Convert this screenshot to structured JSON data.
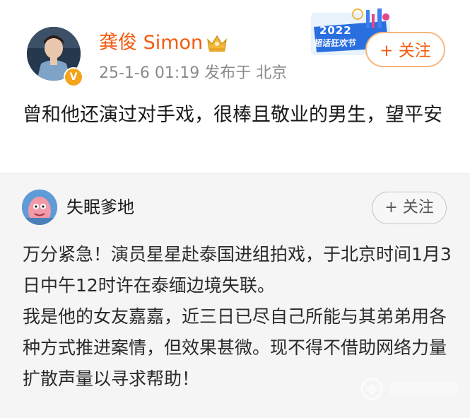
{
  "post": {
    "username": "龚俊 Simon",
    "meta": "25-1-6 01:19  发布于 北京",
    "follow_label": "+ 关注",
    "text": "曾和他还演过对手戏，很棒且敬业的男生，望平安",
    "banner_year": "2022",
    "banner_label": "超话狂欢节",
    "verified_badge": "V"
  },
  "repost": {
    "username": "失眠爹地",
    "follow_label": "+ 关注",
    "paragraphs": [
      "万分紧急！演员星星赴泰国进组拍戏，于北京时间1月3日中午12时许在泰缅边境失联。",
      "我是他的女友嘉嘉，近三日已尽自己所能与其弟弟用各种方式推进案情，但效果甚微。现不得不借助网络力量扩散声量以寻求帮助！"
    ]
  },
  "icons": {
    "crown": "crown-icon",
    "verified": "verified-badge-icon"
  },
  "colors": {
    "username_orange": "#f25b0f",
    "follow_border": "#f6b77f",
    "meta_gray": "#8a8a8a",
    "repost_bg": "#f5f5f5"
  }
}
